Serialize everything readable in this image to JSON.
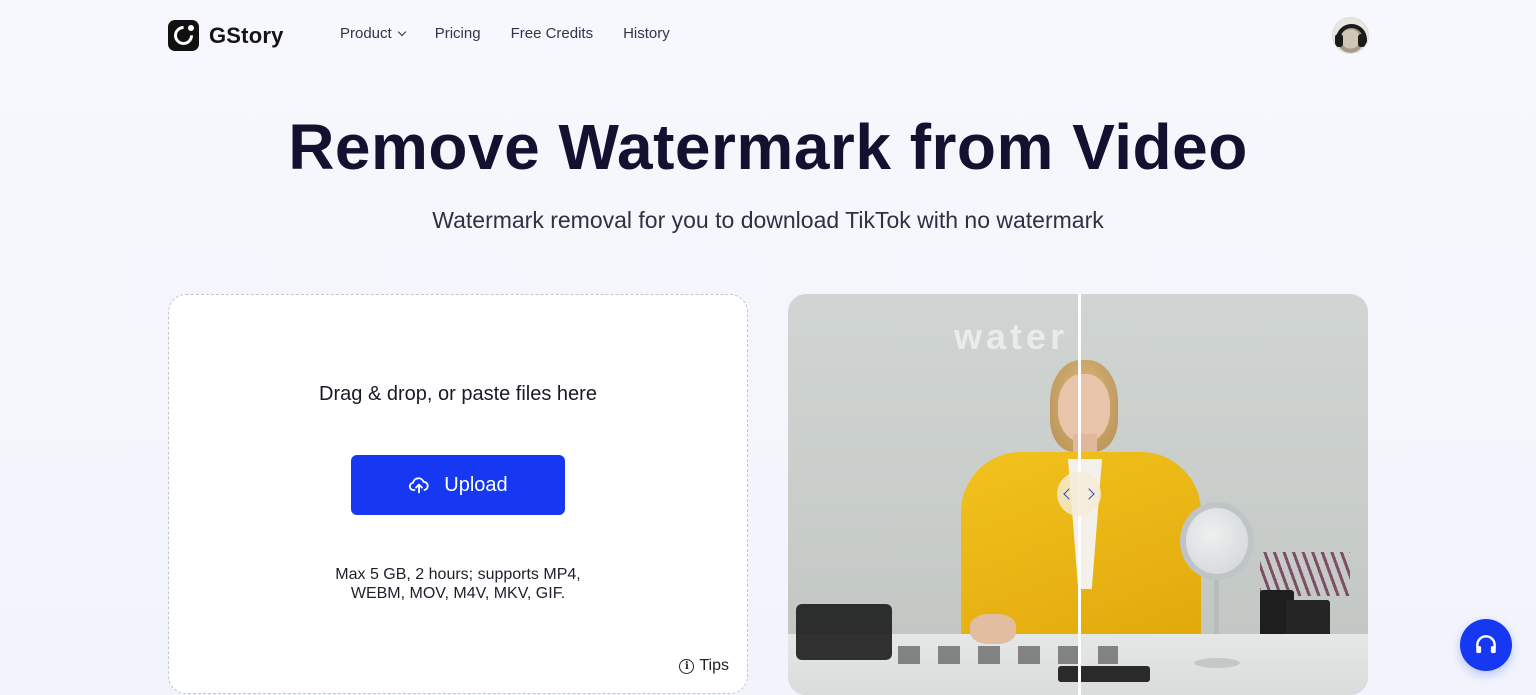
{
  "brand": {
    "name": "GStory"
  },
  "nav": {
    "items": [
      {
        "label": "Product",
        "has_dropdown": true
      },
      {
        "label": "Pricing"
      },
      {
        "label": "Free Credits"
      },
      {
        "label": "History"
      }
    ]
  },
  "hero": {
    "title": "Remove Watermark from Video",
    "subtitle": "Watermark removal for you to download TikTok with no watermark"
  },
  "upload": {
    "drop_text": "Drag & drop, or paste files here",
    "button_label": "Upload",
    "limits_line1": "Max 5 GB, 2 hours; supports MP4,",
    "limits_line2": "WEBM, MOV, M4V, MKV, GIF.",
    "tips_label": "Tips"
  },
  "preview": {
    "watermark_text": "water"
  },
  "colors": {
    "accent": "#1738f3",
    "title": "#13112f",
    "background": "#f5f6fc"
  },
  "icons": {
    "upload": "cloud-upload-icon",
    "tips": "info-icon",
    "support": "headset-icon",
    "nav_dropdown": "chevron-down-icon"
  }
}
